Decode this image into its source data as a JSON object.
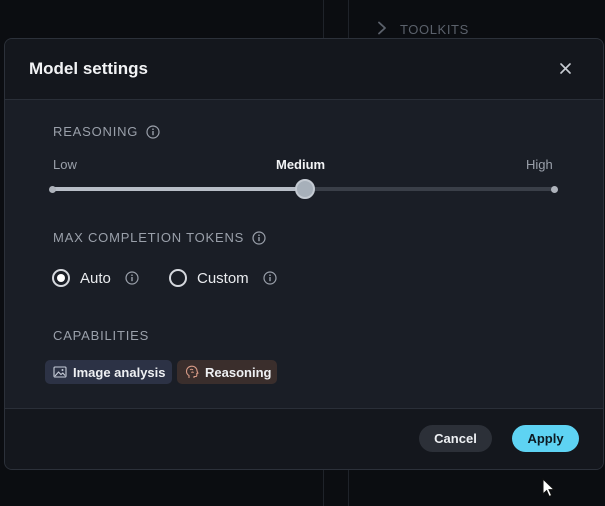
{
  "background": {
    "toolkits_label": "TOOLKITS"
  },
  "modal": {
    "title": "Model settings",
    "reasoning": {
      "label": "REASONING",
      "levels": [
        "Low",
        "Medium",
        "High"
      ],
      "selected": "Medium",
      "value_fraction": 0.5
    },
    "max_tokens": {
      "label": "MAX COMPLETION TOKENS",
      "options": [
        "Auto",
        "Custom"
      ],
      "selected": "Auto"
    },
    "capabilities": {
      "label": "CAPABILITIES",
      "items": [
        "Image analysis",
        "Reasoning"
      ]
    },
    "footer": {
      "cancel_label": "Cancel",
      "apply_label": "Apply"
    }
  },
  "colors": {
    "accent": "#5ed3f3",
    "modal_bg": "#1a1e26",
    "header_bg": "#14171d"
  }
}
